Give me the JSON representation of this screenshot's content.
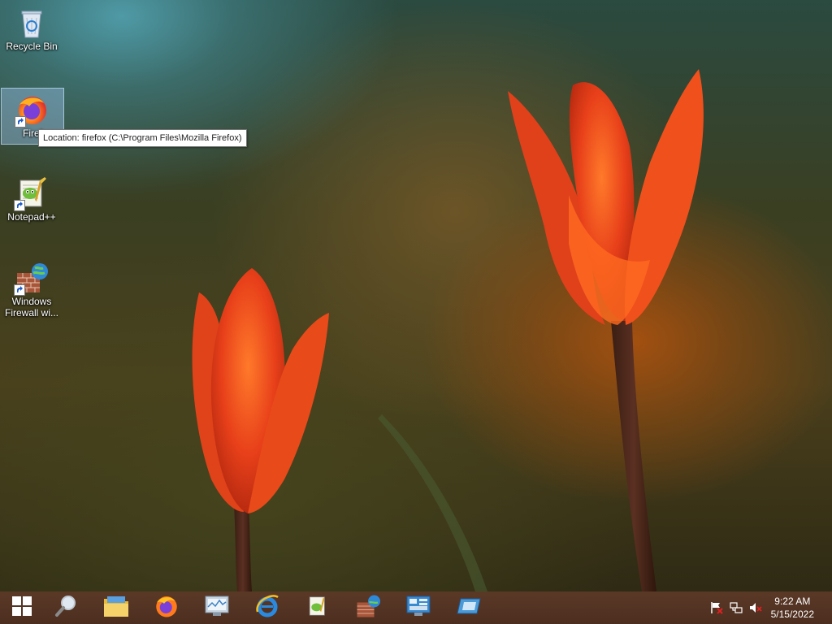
{
  "desktop": {
    "icons": [
      {
        "label": "Recycle Bin",
        "icon": "recycle-bin-icon"
      },
      {
        "label": "Firefox",
        "icon": "firefox-icon"
      },
      {
        "label": "Notepad++",
        "icon": "notepad-plus-plus-icon"
      },
      {
        "label_line1": "Windows",
        "label_line2": "Firewall wi...",
        "icon": "firewall-icon"
      }
    ],
    "firefox_visible_label": "Firef"
  },
  "tooltip": {
    "text": "Location: firefox (C:\\Program Files\\Mozilla Firefox)"
  },
  "taskbar": {
    "items": [
      {
        "icon": "windows-start-icon"
      },
      {
        "icon": "search-magnifier-icon"
      },
      {
        "icon": "file-explorer-icon"
      },
      {
        "icon": "firefox-icon"
      },
      {
        "icon": "performance-monitor-icon"
      },
      {
        "icon": "internet-explorer-icon"
      },
      {
        "icon": "notepad-plus-plus-icon"
      },
      {
        "icon": "firewall-icon"
      },
      {
        "icon": "control-panel-icon"
      },
      {
        "icon": "remote-desktop-icon"
      }
    ],
    "tray": [
      {
        "icon": "action-center-flag-icon"
      },
      {
        "icon": "network-icon"
      },
      {
        "icon": "volume-muted-icon"
      }
    ],
    "clock": {
      "time": "9:22 AM",
      "date": "5/15/2022"
    }
  },
  "colors": {
    "taskbar": "#5a3626",
    "selection": "#9cc0e4",
    "tulip": "#f04a1a"
  }
}
